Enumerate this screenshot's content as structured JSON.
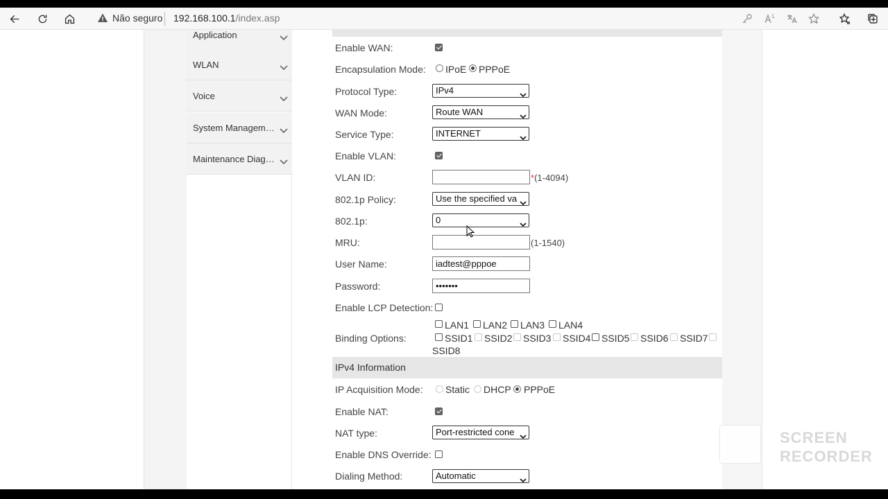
{
  "browser": {
    "not_secure_label": "Não seguro",
    "url_host": "192.168.100.1",
    "url_path": "/index.asp",
    "icons": [
      "back-icon",
      "refresh-icon",
      "home-icon",
      "warning-icon",
      "key-icon",
      "read-aloud-icon",
      "translate-icon",
      "favorite-add-icon",
      "favorites-icon",
      "collections-icon"
    ]
  },
  "sidebar": {
    "items": [
      {
        "label": "Application"
      },
      {
        "label": "WLAN"
      },
      {
        "label": "Voice"
      },
      {
        "label": "System Management"
      },
      {
        "label": "Maintenance Diagno..."
      }
    ]
  },
  "form": {
    "enable_wan": {
      "label": "Enable WAN:",
      "checked": true
    },
    "encapsulation": {
      "label": "Encapsulation Mode:",
      "options": [
        "IPoE",
        "PPPoE"
      ],
      "selected": "PPPoE"
    },
    "protocol_type": {
      "label": "Protocol Type:",
      "value": "IPv4"
    },
    "wan_mode": {
      "label": "WAN Mode:",
      "value": "Route WAN"
    },
    "service_type": {
      "label": "Service Type:",
      "value": "INTERNET"
    },
    "enable_vlan": {
      "label": "Enable VLAN:",
      "checked": true
    },
    "vlan_id": {
      "label": "VLAN ID:",
      "value": "",
      "required_mark": "*",
      "hint": "(1-4094)"
    },
    "policy_8021p": {
      "label": "802.1p Policy:",
      "value": "Use the specified value"
    },
    "value_8021p": {
      "label": "802.1p:",
      "value": "0"
    },
    "mru": {
      "label": "MRU:",
      "value": "",
      "hint": "(1-1540)"
    },
    "user_name": {
      "label": "User Name:",
      "value": "iadtest@pppoe"
    },
    "password": {
      "label": "Password:",
      "value": "•••••••"
    },
    "enable_lcp": {
      "label": "Enable LCP Detection:",
      "checked": false
    },
    "binding": {
      "label": "Binding Options:",
      "lan": [
        "LAN1",
        "LAN2",
        "LAN3",
        "LAN4"
      ],
      "ssid": [
        "SSID1",
        "SSID2",
        "SSID3",
        "SSID4",
        "SSID5",
        "SSID6",
        "SSID7",
        "SSID8"
      ]
    }
  },
  "ipv4": {
    "section_title": "IPv4 Information",
    "acquisition": {
      "label": "IP Acquisition Mode:",
      "options": [
        "Static",
        "DHCP",
        "PPPoE"
      ],
      "selected": "PPPoE"
    },
    "enable_nat": {
      "label": "Enable NAT:",
      "checked": true
    },
    "nat_type": {
      "label": "NAT type:",
      "value": "Port-restricted cone NAT"
    },
    "dns_override": {
      "label": "Enable DNS Override:",
      "checked": false
    },
    "dialing_method": {
      "label": "Dialing Method:",
      "value": "Automatic"
    }
  },
  "watermark": {
    "line1": "SCREEN",
    "line2": "RECORDER"
  }
}
